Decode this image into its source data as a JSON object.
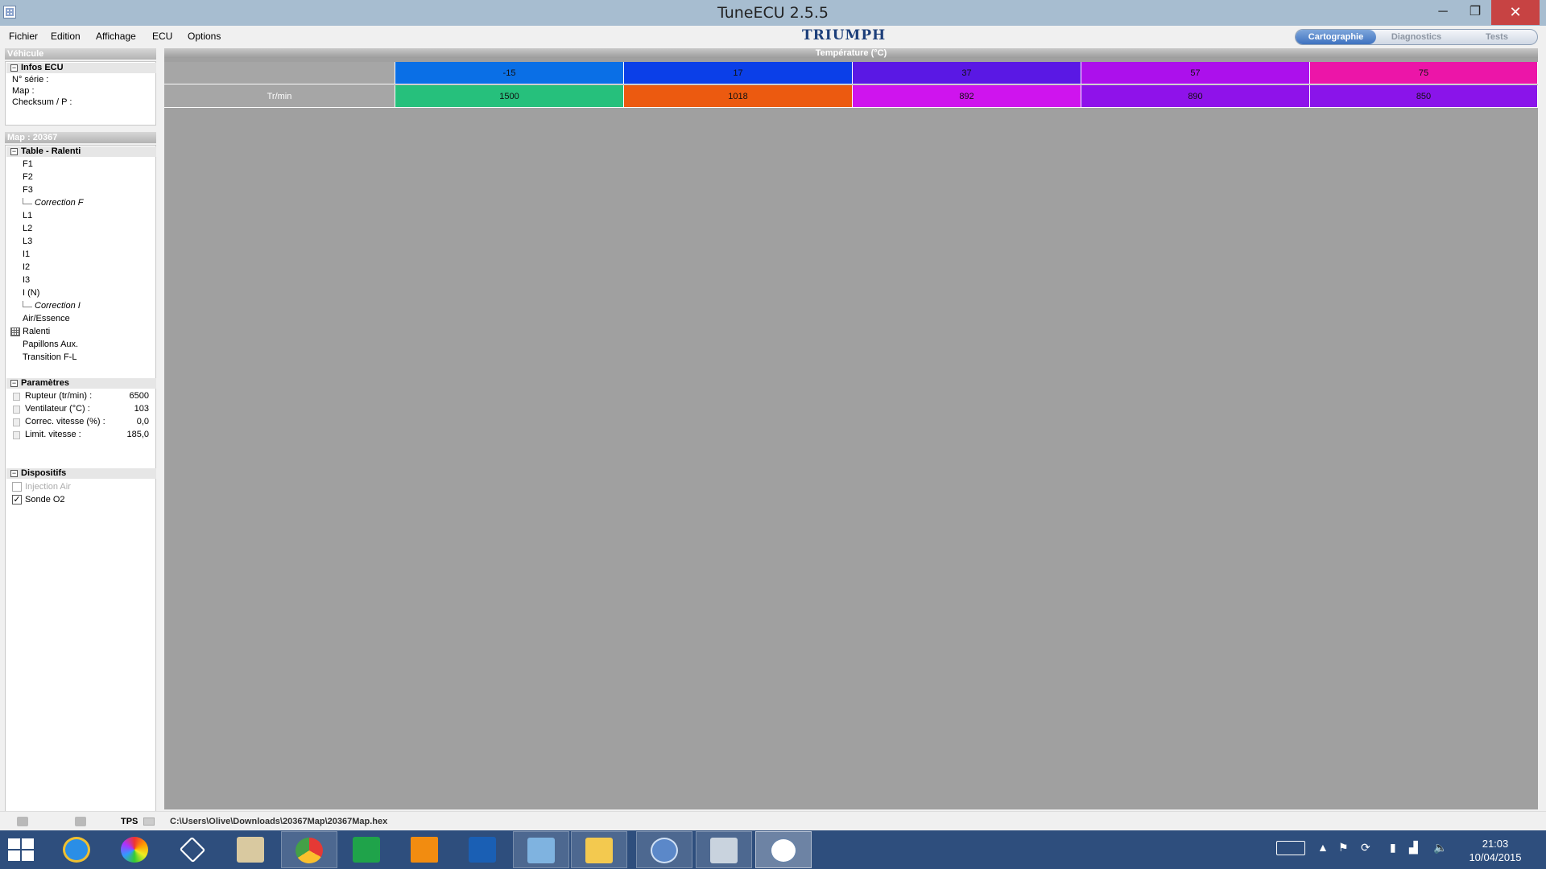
{
  "window": {
    "title": "TuneECU 2.5.5",
    "minimize": "─",
    "maximize": "❐",
    "close": "✕"
  },
  "menu": [
    "Fichier",
    "Edition",
    "Affichage",
    "ECU",
    "Options"
  ],
  "brand": "TRIUMPH",
  "mode_tabs": [
    "Cartographie",
    "Diagnostics",
    "Tests"
  ],
  "active_tab": "Cartographie",
  "left_panel": {
    "vehicle_header": "Véhicule",
    "infos_ecu": {
      "title": "Infos ECU",
      "expander": "−",
      "rows": [
        "N° série :",
        "Map :",
        "Checksum / P :"
      ]
    },
    "map_header": "Map : 20367",
    "table": {
      "title": "Table - Ralenti",
      "expander": "−",
      "items": [
        {
          "label": "F1"
        },
        {
          "label": "F2"
        },
        {
          "label": "F3"
        },
        {
          "label": "Correction F",
          "sub": true
        },
        {
          "label": "L1"
        },
        {
          "label": "L2"
        },
        {
          "label": "L3"
        },
        {
          "label": "I1"
        },
        {
          "label": "I2"
        },
        {
          "label": "I3"
        },
        {
          "label": "I (N)"
        },
        {
          "label": "Correction I",
          "sub": true
        },
        {
          "label": "Air/Essence"
        },
        {
          "label": "Ralenti",
          "selected": true
        },
        {
          "label": "Papillons Aux."
        },
        {
          "label": "Transition F-L"
        }
      ]
    },
    "parametres": {
      "title": "Paramètres",
      "expander": "−",
      "items": [
        {
          "label": "Rupteur (tr/min) :",
          "value": "6500"
        },
        {
          "label": "Ventilateur (°C) :",
          "value": "103"
        },
        {
          "label": "Correc. vitesse (%) :",
          "value": "0,0"
        },
        {
          "label": "Limit. vitesse :",
          "value": "185,0"
        }
      ]
    },
    "dispositifs": {
      "title": "Dispositifs",
      "expander": "−",
      "items": [
        {
          "label": "Injection Air",
          "checked": false,
          "enabled": false,
          "mark": ""
        },
        {
          "label": "Sonde O2",
          "checked": true,
          "enabled": true,
          "mark": "✓"
        }
      ]
    }
  },
  "grid": {
    "column_header": "Température (°C)",
    "row_label": "Tr/min",
    "columns": [
      {
        "temp": "-15",
        "rpm": "1500",
        "temp_color": "#0a6fe6",
        "rpm_color": "#26c07c"
      },
      {
        "temp": "17",
        "rpm": "1018",
        "temp_color": "#0b3fe8",
        "rpm_color": "#ec5a10"
      },
      {
        "temp": "37",
        "rpm": "892",
        "temp_color": "#5a18e4",
        "rpm_color": "#cf14ee"
      },
      {
        "temp": "57",
        "rpm": "890",
        "temp_color": "#ac10ec",
        "rpm_color": "#8f12ea"
      },
      {
        "temp": "75",
        "rpm": "850",
        "temp_color": "#ec15a8",
        "rpm_color": "#8a14ea"
      }
    ]
  },
  "status_bar": {
    "tps_label": "TPS",
    "file_path": "C:\\Users\\Olive\\Downloads\\20367Map\\20367Map.hex"
  },
  "taskbar": {
    "apps": [
      "internet-explorer",
      "picasa",
      "teamviewer",
      "notepad",
      "chrome",
      "store",
      "vlc",
      "samsung",
      "control-panel",
      "file-explorer",
      "qbittorrent",
      "performance-monitor",
      "tuneecu"
    ],
    "active_app": "tuneecu",
    "clock_time": "21:03",
    "clock_date": "10/04/2015"
  }
}
